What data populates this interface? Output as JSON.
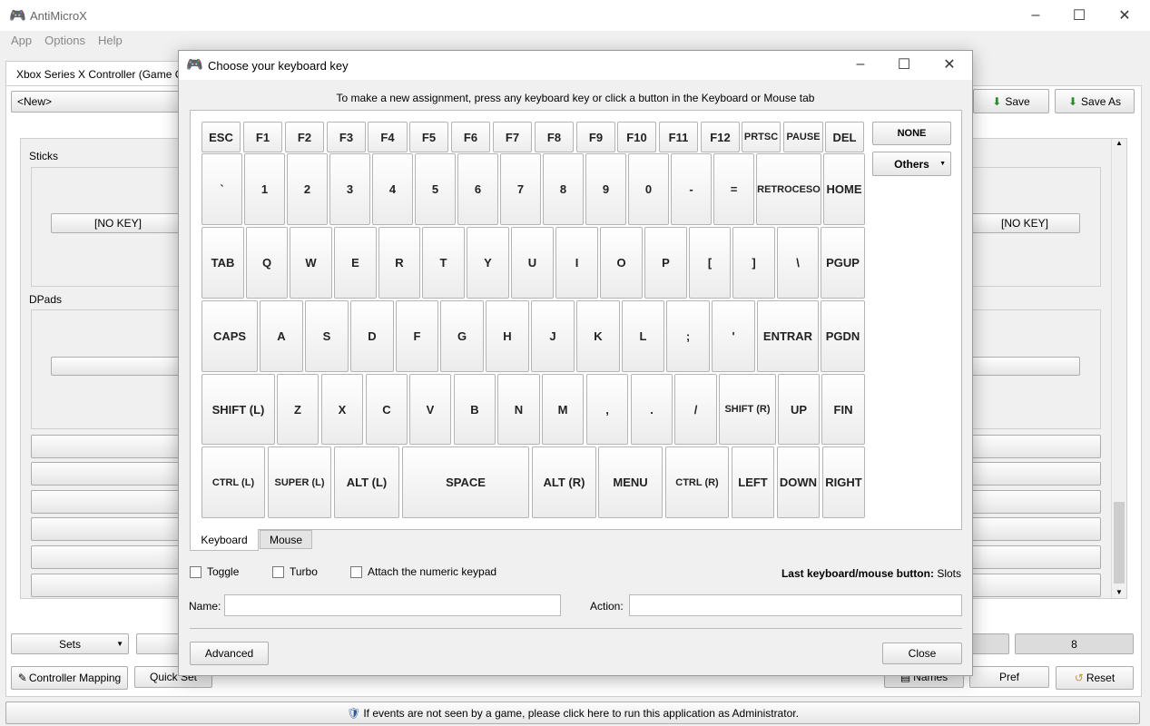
{
  "app": {
    "title": "AntiMicroX",
    "menu": [
      "App",
      "Options",
      "Help"
    ],
    "controller_tab": "Xbox Series X Controller (Game Co",
    "profile": "<New>",
    "save": "Save",
    "save_as": "Save As",
    "sticks": "Sticks",
    "dpads": "DPads",
    "no_key": "[NO KEY]",
    "sets": "Sets",
    "set_8": "8",
    "controller_mapping": "Controller Mapping",
    "quick_set": "Quick Set",
    "names": "Names",
    "pref": "Pref",
    "reset": "Reset",
    "admin_notice": "If events are not seen by a game, please click here to run this application as Administrator."
  },
  "dialog": {
    "title": "Choose your keyboard key",
    "instruction": "To make a new assignment, press any keyboard key or click a button in the Keyboard or Mouse tab",
    "none": "NONE",
    "others": "Others",
    "rows": [
      [
        "ESC",
        "F1",
        "F2",
        "F3",
        "F4",
        "F5",
        "F6",
        "F7",
        "F8",
        "F9",
        "F10",
        "F11",
        "F12",
        "PRTSC",
        "PAUSE",
        "DEL"
      ],
      [
        "`",
        "1",
        "2",
        "3",
        "4",
        "5",
        "6",
        "7",
        "8",
        "9",
        "0",
        "-",
        "=",
        "RETROCESO",
        "HOME"
      ],
      [
        "TAB",
        "Q",
        "W",
        "E",
        "R",
        "T",
        "Y",
        "U",
        "I",
        "O",
        "P",
        "[",
        "]",
        "\\",
        "PGUP"
      ],
      [
        "CAPS",
        "A",
        "S",
        "D",
        "F",
        "G",
        "H",
        "J",
        "K",
        "L",
        ";",
        "'",
        "ENTRAR",
        "PGDN"
      ],
      [
        "SHIFT (L)",
        "Z",
        "X",
        "C",
        "V",
        "B",
        "N",
        "M",
        ",",
        ".",
        "/",
        "SHIFT (R)",
        "UP",
        "FIN"
      ],
      [
        "CTRL (L)",
        "SUPER (L)",
        "ALT (L)",
        "SPACE",
        "ALT (R)",
        "MENU",
        "CTRL (R)",
        "LEFT",
        "DOWN",
        "RIGHT"
      ]
    ],
    "tabs": [
      "Keyboard",
      "Mouse"
    ],
    "active_tab": "Keyboard",
    "toggle": "Toggle",
    "turbo": "Turbo",
    "numeric": "Attach the numeric keypad",
    "last_label": "Last keyboard/mouse button:",
    "last_value": "Slots",
    "name_label": "Name:",
    "name_value": "",
    "action_label": "Action:",
    "action_value": "",
    "advanced": "Advanced",
    "close": "Close"
  }
}
